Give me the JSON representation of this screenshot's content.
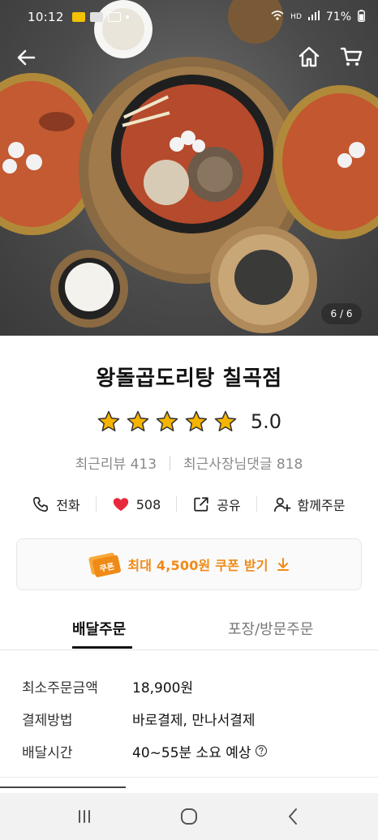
{
  "status_bar": {
    "time": "10:12",
    "battery": "71%",
    "network": "HD"
  },
  "hero": {
    "photo_counter": "6 / 6"
  },
  "store": {
    "name": "왕돌곱도리탕 칠곡점",
    "rating": "5.0",
    "rating_value": 5,
    "recent_reviews": "최근리뷰 413",
    "owner_replies": "최근사장님댓글 818"
  },
  "actions": {
    "call": "전화",
    "likes": "508",
    "share": "공유",
    "group_order": "함께주문"
  },
  "coupon": {
    "badge": "쿠폰",
    "text": "최대 4,500원 쿠폰 받기"
  },
  "tabs": {
    "delivery": "배달주문",
    "pickup": "포장/방문주문"
  },
  "info": [
    {
      "label": "최소주문금액",
      "value": "18,900원"
    },
    {
      "label": "결제방법",
      "value": "바로결제, 만나서결제"
    },
    {
      "label": "배달시간",
      "value": "40~55분 소요 예상"
    }
  ],
  "colors": {
    "accent_orange": "#f08a17",
    "heart_red": "#e8283c",
    "star_yellow": "#f5b400"
  },
  "icons": [
    "back-arrow-icon",
    "home-icon",
    "cart-icon",
    "phone-icon",
    "heart-icon",
    "share-icon",
    "add-person-icon",
    "download-arrow-icon",
    "help-icon",
    "recents-icon",
    "home-circle-icon",
    "back-chevron-icon"
  ]
}
